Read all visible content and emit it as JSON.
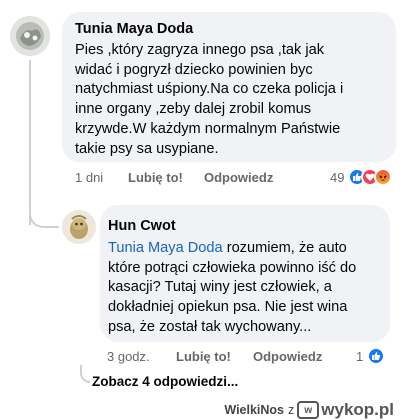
{
  "comments": [
    {
      "author": "Tunia Maya Doda",
      "lines": [
        "Pies ,który zagryza innego psa ,tak jak",
        "widać i pogryzł dziecko powinien byc",
        "natychmiast uśpiony.Na co czeka policja i",
        "inne organy ,zeby dalej zrobil komus",
        "krzywde.W każdym normalnym Państwie",
        "takie psy sa usypiane."
      ],
      "time": "1 dni",
      "like_label": "Lubię to!",
      "reply_label": "Odpowiedz",
      "reaction_count": "49",
      "reaction_icons": [
        "like-icon",
        "love-icon",
        "angry-icon"
      ]
    },
    {
      "author": "Hun Cwot",
      "mention": "Tunia Maya Doda",
      "first_line_rest": " rozumiem, że auto",
      "lines": [
        "które potrąci człowieka powinno iść do",
        "kasacji? Tutaj winy jest człowiek, a",
        "dokładniej opiekun psa. Nie jest wina",
        "psa, że został tak wychowany..."
      ],
      "time": "3 godz.",
      "like_label": "Lubię to!",
      "reply_label": "Odpowiedz",
      "reaction_count": "1",
      "reaction_icons": [
        "like-icon"
      ]
    }
  ],
  "more_replies_label": "Zobacz 4 odpowiedzi...",
  "watermark": {
    "user": "WielkiNos",
    "preposition": "z",
    "site": "wykop.pl"
  },
  "colors": {
    "bubble": "#f0f2f5",
    "like_blue": "#1877f2",
    "love_red": "#f33e58",
    "angry_orange": "#f7714c",
    "mention_blue": "#1565c0",
    "meta_gray": "#65676b"
  }
}
